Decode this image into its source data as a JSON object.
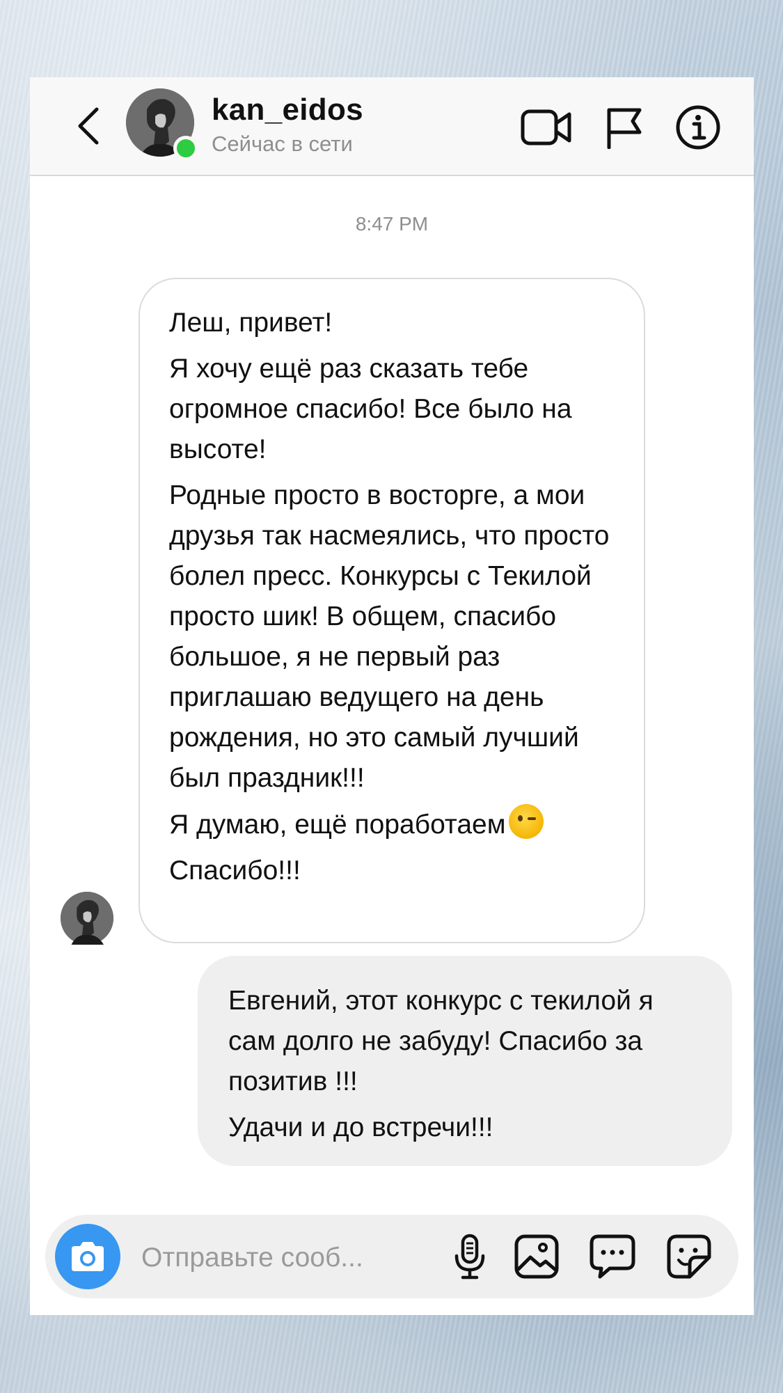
{
  "header": {
    "username": "kan_eidos",
    "status": "Сейчас в сети"
  },
  "icons": {
    "back": "chevron-left-icon",
    "video": "video-camera-icon",
    "flag": "flag-icon",
    "info": "info-icon",
    "camera": "camera-icon",
    "mic": "microphone-icon",
    "gallery": "image-icon",
    "chat": "chat-bubble-icon",
    "sticker": "sticker-icon"
  },
  "colors": {
    "online": "#2ecc40",
    "camera_button": "#3897f0",
    "outgoing_bubble": "#efefef"
  },
  "thread": {
    "timestamp": "8:47 PM",
    "incoming": {
      "p1": "Леш, привет!",
      "p2": "Я хочу ещё раз сказать тебе огромное спасибо! Все было на высоте!",
      "p3": "Родные просто в восторге, а мои друзья так насмеялись, что просто болел пресс. Конкурсы с Текилой просто шик! В общем, спасибо большое, я не первый раз приглашаю ведущего на день рождения, но это самый лучший был праздник!!!",
      "p4": "Я думаю, ещё поработаем",
      "p4_emoji": "😉",
      "p5": "Спасибо!!!"
    },
    "outgoing": {
      "p1": "Евгений, этот конкурс с текилой я сам долго не забуду! Спасибо за позитив !!!",
      "p2": "Удачи и до встречи!!!"
    }
  },
  "composer": {
    "placeholder": "Отправьте сооб..."
  }
}
